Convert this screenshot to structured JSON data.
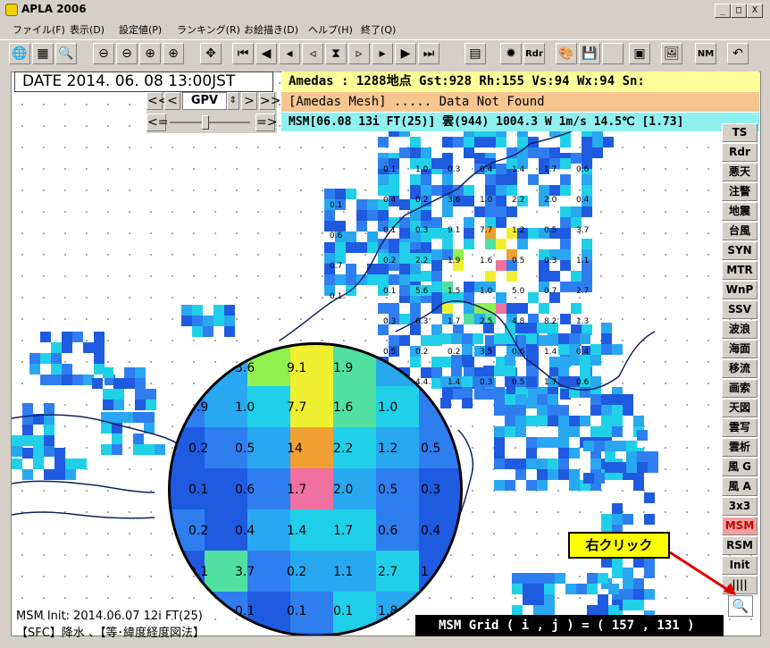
{
  "window": {
    "title": "APLA 2006",
    "min_label": "_",
    "max_label": "□",
    "close_label": "X"
  },
  "menu": [
    "ファイル(F)",
    "表示(D)",
    "設定値(P)",
    "ランキング(R)",
    "お絵描き(D)",
    "ヘルプ(H)",
    "終了(Q)"
  ],
  "toolbar": {
    "radar_label": "Rdr",
    "nm_label": "NM",
    "undo_label": "↶"
  },
  "overlay": {
    "date": "DATE 2014. 06. 08  13:00JST",
    "amedas": "Amedas : 1288地点   Gst:928  Rh:155  Vs:94  Wx:94  Sn:",
    "mesh": "[Amedas Mesh] ..... Data Not Found",
    "msm": "MSM[06.08 13i FT(25)] 雲(944) 1004.3 W    1m/s 14.5℃ [1.73]"
  },
  "gpv": {
    "prev_prev": "<<",
    "prev": "<",
    "label": "GPV",
    "next": ">",
    "next_next": ">>",
    "left": "<=",
    "right": "=>"
  },
  "sidebar": [
    {
      "label": "TS"
    },
    {
      "label": "Rdr"
    },
    {
      "label": "悪天"
    },
    {
      "label": "注警"
    },
    {
      "label": "地震"
    },
    {
      "label": "台風"
    },
    {
      "label": "SYN"
    },
    {
      "label": "MTR"
    },
    {
      "label": "WnP"
    },
    {
      "label": "SSV"
    },
    {
      "label": "波浪"
    },
    {
      "label": "海面"
    },
    {
      "label": "移流"
    },
    {
      "label": "画索"
    },
    {
      "label": "天図"
    },
    {
      "label": "雲写"
    },
    {
      "label": "雲析"
    },
    {
      "label": "風 G"
    },
    {
      "label": "風 A"
    },
    {
      "label": "3x3"
    },
    {
      "label": "MSM"
    },
    {
      "label": "RSM"
    },
    {
      "label": "Init"
    },
    {
      "label": "||||"
    }
  ],
  "magnifier": {
    "values": [
      "3.6",
      "9.1",
      "1.9",
      "0.9",
      "1.0",
      "7.7",
      "1.6",
      "1.0",
      "0.2",
      "0.5",
      "14",
      "2.2",
      "1.2",
      "0.5",
      "0.1",
      "0.6",
      "1.7",
      "2.0",
      "0.5",
      "0.3",
      "0.2",
      "0.4",
      "1.4",
      "1.7",
      "0.6",
      "0.4",
      "0.1",
      "3.7",
      "0.2",
      "1.1",
      "2.7",
      "1",
      "0.1",
      "0.1",
      "0.1",
      "1.8"
    ]
  },
  "map_labels": [
    "0.1",
    "0.4",
    "0.1",
    "0.2",
    "0.1",
    "0.3",
    "0.5",
    "0.4",
    "1.0",
    "0.2",
    "0.3",
    "2.2",
    "5.6",
    "6.3",
    "0.2",
    "4.4",
    "0.3",
    "3.6",
    "9.1",
    "1.9",
    "1.5",
    "1.7",
    "0.2",
    "1.4",
    "0.4",
    "1.0",
    "7.7",
    "1.6",
    "1.0",
    "2.5",
    "3.5",
    "0.3",
    "1.4",
    "2.2",
    "1.2",
    "0.5",
    "5.0",
    "4.8",
    "0.6",
    "0.5",
    "1.7",
    "2.0",
    "0.5",
    "0.3",
    "0.7",
    "8.2",
    "1.4",
    "1.7",
    "0.6",
    "0.4",
    "3.7",
    "1.1",
    "2.7",
    "1.3",
    "0.4",
    "0.6",
    "0.1",
    "0.6",
    "0.7",
    "0.1"
  ],
  "callout": {
    "text": "右クリック"
  },
  "bottom": {
    "init": "MSM Init: 2014.06.07 12i FT(25)",
    "legend": "【SFC】降水 、【等･緯度経度図法】",
    "grid": "MSM Grid ( i , j ) = ( 157 , 131 )"
  }
}
